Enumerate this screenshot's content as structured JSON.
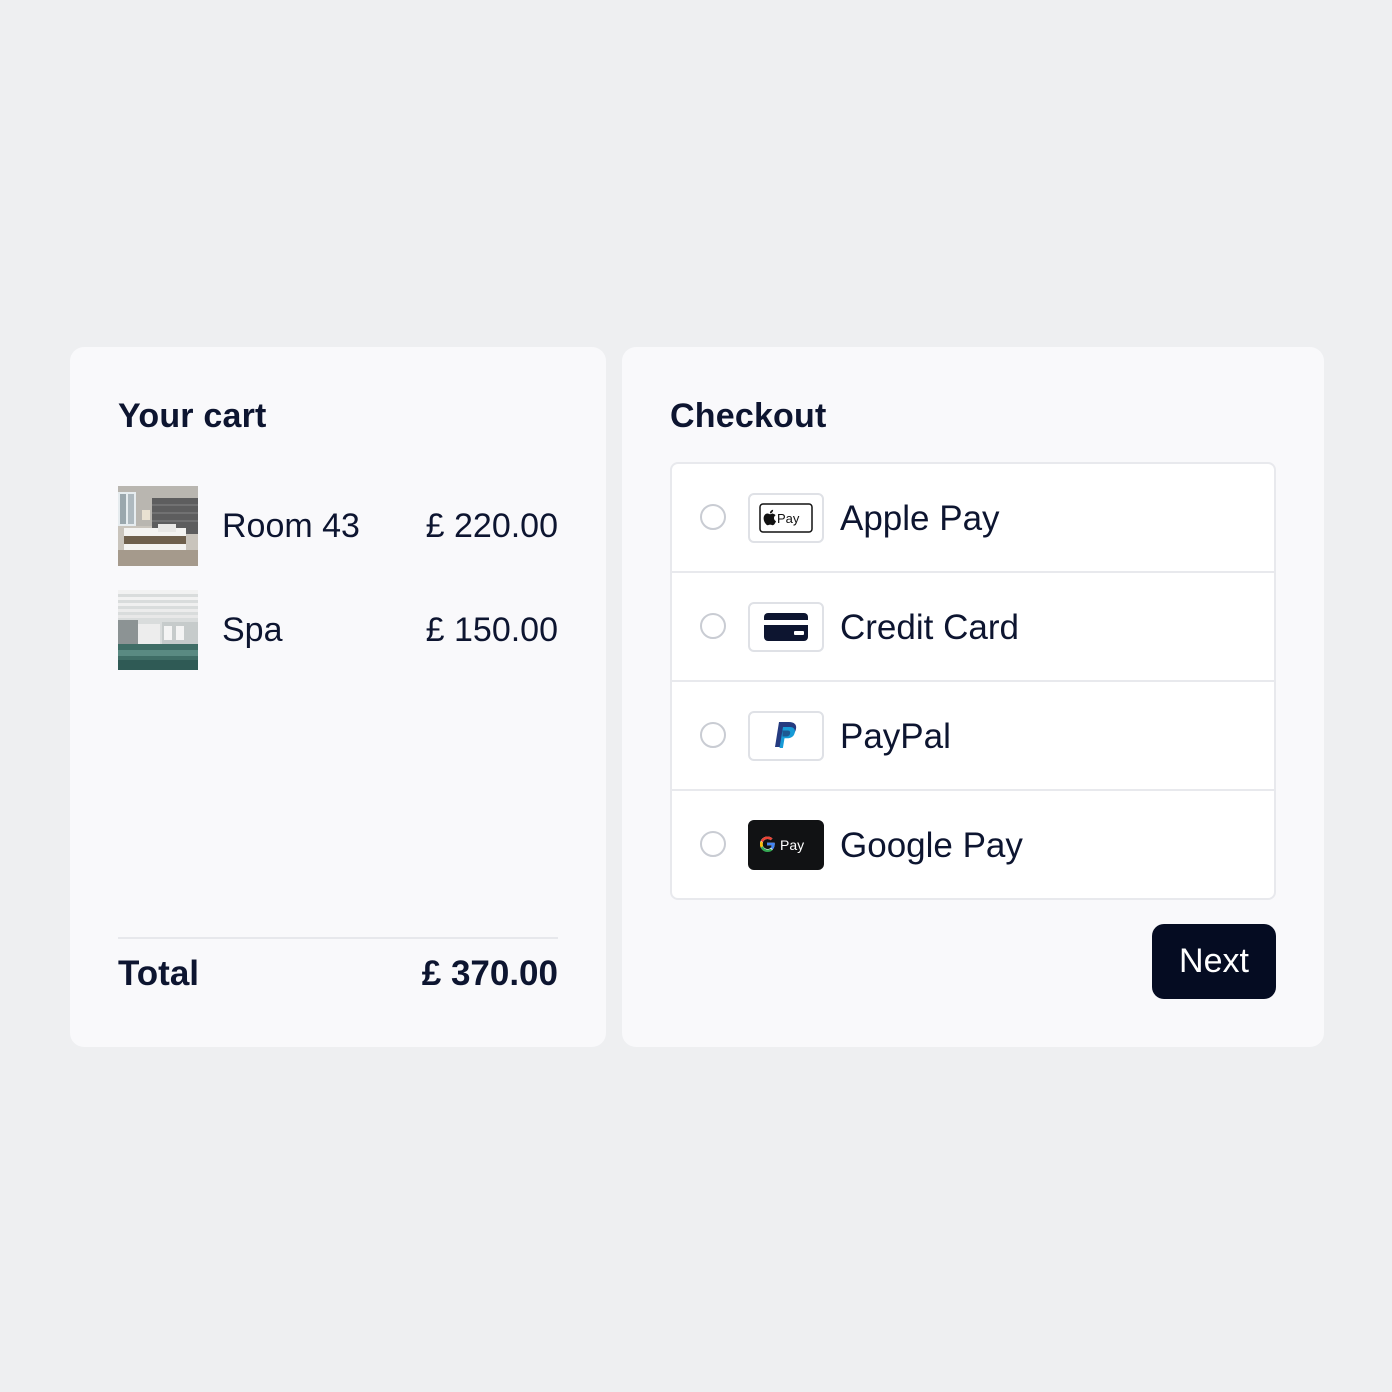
{
  "cart": {
    "title": "Your cart",
    "items": [
      {
        "name": "Room 43",
        "price": "£ 220.00",
        "image": "hotel-room-photo"
      },
      {
        "name": "Spa",
        "price": "£ 150.00",
        "image": "spa-pool-photo"
      }
    ],
    "total_label": "Total",
    "total_value": "£ 370.00"
  },
  "checkout": {
    "title": "Checkout",
    "methods": [
      {
        "label": "Apple Pay",
        "icon": "apple-pay-icon",
        "badge_text": "Pay",
        "selected": false
      },
      {
        "label": "Credit Card",
        "icon": "credit-card-icon",
        "selected": false
      },
      {
        "label": "PayPal",
        "icon": "paypal-icon",
        "selected": false
      },
      {
        "label": "Google Pay",
        "icon": "google-pay-icon",
        "badge_text": "Pay",
        "selected": false
      }
    ],
    "next_label": "Next"
  },
  "colors": {
    "background": "#eeeff1",
    "panel": "#f9f9fb",
    "text": "#0d1530",
    "button": "#050c22"
  }
}
